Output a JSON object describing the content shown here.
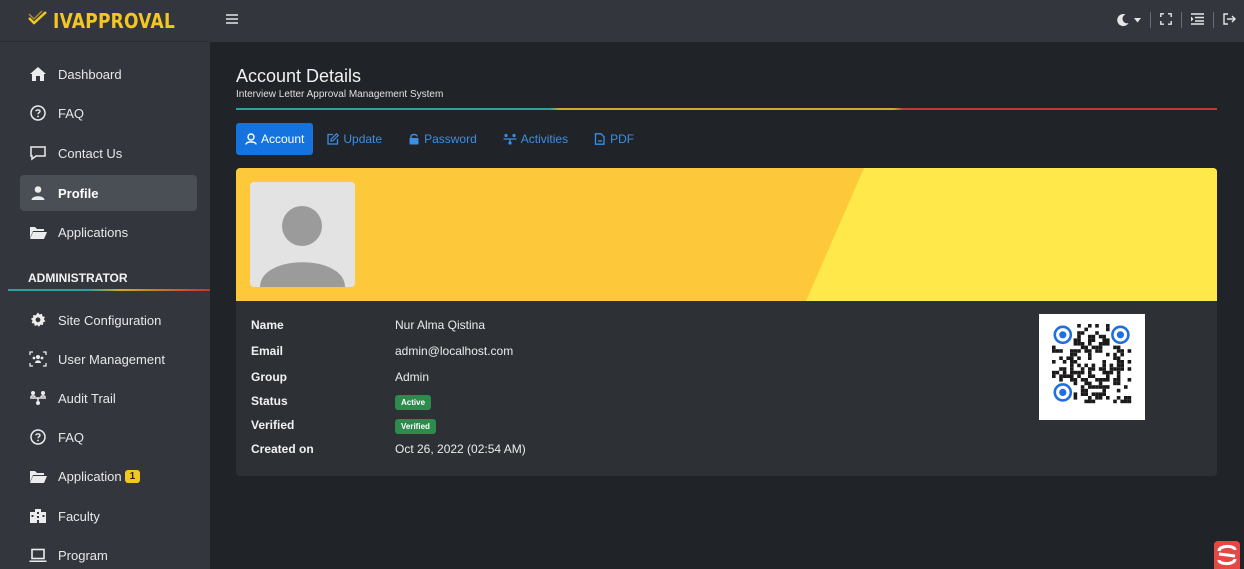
{
  "brand": {
    "name": "IVAPPROVAL",
    "color": "#f3c623"
  },
  "sidebar": {
    "items": [
      {
        "label": "Dashboard",
        "icon": "home-icon"
      },
      {
        "label": "FAQ",
        "icon": "question-circle-icon"
      },
      {
        "label": "Contact Us",
        "icon": "message-icon"
      },
      {
        "label": "Profile",
        "icon": "user-icon",
        "active": true
      },
      {
        "label": "Applications",
        "icon": "folder-open-icon"
      }
    ],
    "section_header": "ADMINISTRATOR",
    "admin_items": [
      {
        "label": "Site Configuration",
        "icon": "cogs-icon"
      },
      {
        "label": "User Management",
        "icon": "users-frame-icon"
      },
      {
        "label": "Audit Trail",
        "icon": "sitemap-icon"
      },
      {
        "label": "FAQ",
        "icon": "question-circle-icon"
      },
      {
        "label": "Application",
        "icon": "folder-open-icon",
        "badge": "1"
      },
      {
        "label": "Faculty",
        "icon": "building-icon"
      },
      {
        "label": "Program",
        "icon": "laptop-icon"
      }
    ]
  },
  "topbar": {
    "menu_icon": "hamburger-icon",
    "tools": [
      "theme-moon-icon",
      "fullscreen-icon",
      "list-icon",
      "logout-icon"
    ]
  },
  "page": {
    "title": "Account Details",
    "subtitle": "Interview Letter Approval Management System"
  },
  "tabs": [
    {
      "label": "Account",
      "icon": "user-badge-icon",
      "active": true
    },
    {
      "label": "Update",
      "icon": "edit-icon"
    },
    {
      "label": "Password",
      "icon": "lock-icon"
    },
    {
      "label": "Activities",
      "icon": "sitemap-icon"
    },
    {
      "label": "PDF",
      "icon": "file-pdf-icon"
    }
  ],
  "profile": {
    "fields": [
      {
        "label": "Name",
        "value": "Nur Alma Qistina"
      },
      {
        "label": "Email",
        "value": "admin@localhost.com"
      },
      {
        "label": "Group",
        "value": "Admin"
      },
      {
        "label": "Status",
        "value": "Active",
        "pill": true
      },
      {
        "label": "Verified",
        "value": "Verified",
        "pill": true
      },
      {
        "label": "Created on",
        "value": "Oct 26, 2022 (02:54 AM)"
      }
    ]
  },
  "colors": {
    "banner_left": "#fdc83a",
    "banner_right": "#ffe84a",
    "accent_blue": "#1573e0",
    "status_green": "#2e8b4e"
  }
}
